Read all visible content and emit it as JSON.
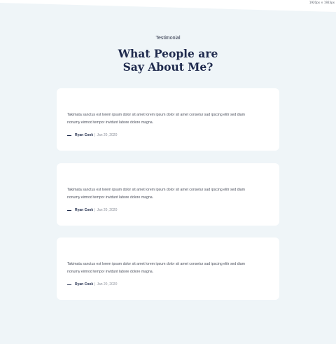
{
  "window": {
    "dimensions_label": "1920px × 1923px"
  },
  "section": {
    "eyebrow": "Testimonial",
    "heading_line1": "What People are",
    "heading_line2": "Say About Me?"
  },
  "testimonials": [
    {
      "quote_line1": "Takimata sanctus est lorem ipsum dolor sit amet lorem ipsum dolor sit amet consetur sad ipscing elitr sed diam",
      "quote_line2": "nonumy eirmod tempor invidunt labore dolore magna.",
      "author": "Ryan Cook",
      "separator": "|",
      "date": "Jan 20, 2020"
    },
    {
      "quote_line1": "Takimata sanctus est lorem ipsum dolor sit amet lorem ipsum dolor sit amet consetur sad ipscing elitr sed diam",
      "quote_line2": "nonumy eirmod tempor invidunt labore dolore magna.",
      "author": "Ryan Cook",
      "separator": "|",
      "date": "Jan 20, 2020"
    },
    {
      "quote_line1": "Takimata sanctus est lorem ipsum dolor sit amet lorem ipsum dolor sit amet consetur sad ipscing elitr sed diam",
      "quote_line2": "nonumy eirmod tempor invidunt labore dolore magna.",
      "author": "Ryan Cook",
      "separator": "|",
      "date": "Jan 20, 2020"
    }
  ],
  "colors": {
    "page_background": "#eff5f8",
    "card_background": "#ffffff",
    "heading": "#1f2a4d",
    "body_text": "#4a4f5c"
  }
}
